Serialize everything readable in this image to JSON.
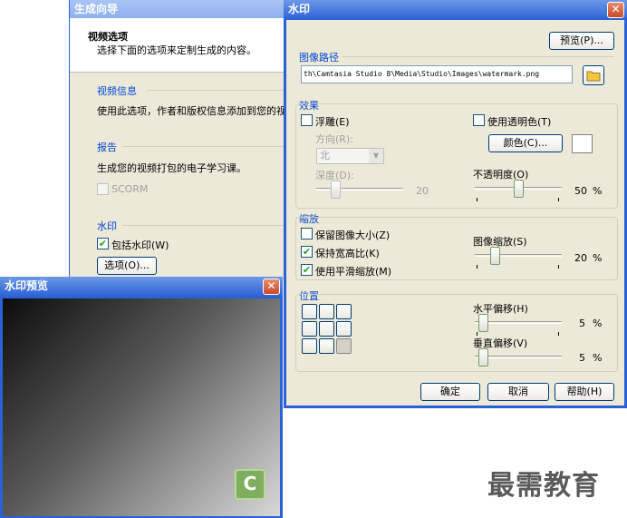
{
  "wizard": {
    "title": "生成向导",
    "section_heading": "视频选项",
    "section_desc": "选择下面的选项来定制生成的内容。",
    "video_info": {
      "title": "视频信息",
      "text": "使用此选项，作者和版权信息添加到您的视"
    },
    "report": {
      "title": "报告",
      "text": "生成您的视频打包的电子学习课。",
      "scorm_label": "SCORM"
    },
    "watermark": {
      "title": "水印",
      "include_label": "包括水印(W)",
      "options_button": "选项(O)..."
    }
  },
  "preview": {
    "title": "水印预览"
  },
  "dialog": {
    "title": "水印",
    "preview_button": "预览(P)...",
    "image_path": {
      "title": "图像路径",
      "value": "th\\Camtasia Studio 8\\Media\\Studio\\Images\\watermark.png"
    },
    "effects": {
      "title": "效果",
      "emboss_label": "浮雕(E)",
      "direction_label": "方向(R):",
      "direction_value": "北",
      "depth_label": "深度(D):",
      "depth_value": "20",
      "transparent_label": "使用透明色(T)",
      "color_button": "颜色(C)...",
      "opacity_label": "不透明度(O)",
      "opacity_value": "50",
      "percent": "%"
    },
    "scaling": {
      "title": "缩放",
      "keep_size_label": "保留图像大小(Z)",
      "keep_aspect_label": "保持宽高比(K)",
      "smooth_label": "使用平滑缩放(M)",
      "image_scale_label": "图像缩放(S)",
      "image_scale_value": "20",
      "percent": "%"
    },
    "position": {
      "title": "位置",
      "h_offset_label": "水平偏移(H)",
      "h_offset_value": "5",
      "v_offset_label": "垂直偏移(V)",
      "v_offset_value": "5",
      "percent": "%"
    },
    "ok_button": "确定",
    "cancel_button": "取消",
    "help_button": "帮助(H)"
  },
  "brand": {
    "text": "最需教育"
  },
  "colors": {
    "titlebar": "#2a61d6",
    "group_title": "#0046d5",
    "window_bg": "#ece9d8",
    "check": "#21a121"
  }
}
